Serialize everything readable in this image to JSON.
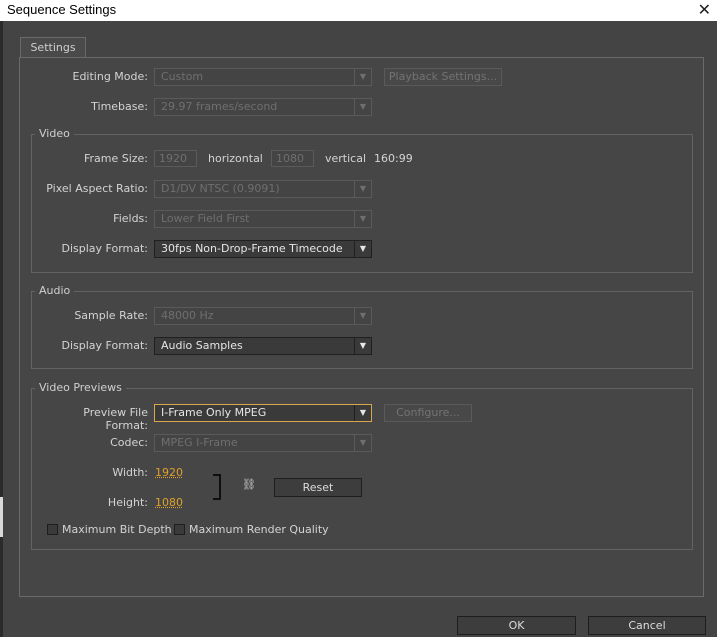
{
  "window": {
    "title": "Sequence Settings",
    "close_glyph": "✕"
  },
  "tabs": [
    {
      "label": "Settings"
    }
  ],
  "general": {
    "editing_mode": {
      "label": "Editing Mode:",
      "value": "Custom"
    },
    "playback_settings_label": "Playback Settings...",
    "timebase": {
      "label": "Timebase:",
      "value": "29.97 frames/second"
    }
  },
  "video": {
    "title": "Video",
    "frame_size": {
      "label": "Frame Size:",
      "width": "1920",
      "horizontal": "horizontal",
      "height": "1080",
      "vertical": "vertical",
      "ratio": "160:99"
    },
    "pixel_aspect_ratio": {
      "label": "Pixel Aspect Ratio:",
      "value": "D1/DV NTSC (0.9091)"
    },
    "fields": {
      "label": "Fields:",
      "value": "Lower Field First"
    },
    "display_format": {
      "label": "Display Format:",
      "value": "30fps Non-Drop-Frame Timecode"
    }
  },
  "audio": {
    "title": "Audio",
    "sample_rate": {
      "label": "Sample Rate:",
      "value": "48000 Hz"
    },
    "display_format": {
      "label": "Display Format:",
      "value": "Audio Samples"
    }
  },
  "video_previews": {
    "title": "Video Previews",
    "preview_file_format": {
      "label": "Preview File Format:",
      "value": "I-Frame Only MPEG"
    },
    "configure_label": "Configure...",
    "codec": {
      "label": "Codec:",
      "value": "MPEG I-Frame"
    },
    "width": {
      "label": "Width:",
      "value": "1920"
    },
    "height": {
      "label": "Height:",
      "value": "1080"
    },
    "reset_label": "Reset",
    "max_bit_depth": {
      "label": "Maximum Bit Depth",
      "checked": false
    },
    "max_render_quality": {
      "label": "Maximum Render Quality",
      "checked": false
    }
  },
  "footer": {
    "ok_label": "OK",
    "cancel_label": "Cancel"
  },
  "colors": {
    "background": "#444444",
    "accent": "#e0a02a",
    "focus_border": "#d8a84a"
  },
  "icons": {
    "dropdown": "chevron-down-icon",
    "link": "chain-link-icon",
    "close": "close-icon"
  }
}
